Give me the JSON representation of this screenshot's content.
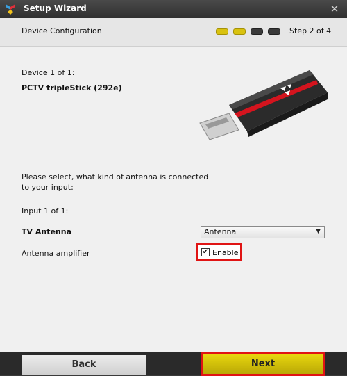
{
  "window": {
    "title": "Setup Wizard",
    "close_glyph": "✕"
  },
  "header": {
    "section": "Device Configuration",
    "step_label": "Step 2 of 4",
    "steps_completed": 2,
    "steps_total": 4
  },
  "device": {
    "counter": "Device 1 of 1:",
    "name": "PCTV tripleStick (292e)",
    "image_icon": "usb-tv-stick-image"
  },
  "antenna": {
    "prompt_line1": "Please select, what kind of antenna is connected",
    "prompt_line2": "to your input:",
    "input_counter": "Input 1 of 1:",
    "type_label": "TV Antenna",
    "type_value": "Antenna",
    "amplifier_label": "Antenna amplifier",
    "amplifier_option": "Enable",
    "amplifier_checked": true
  },
  "footer": {
    "back_label": "Back",
    "next_label": "Next"
  },
  "colors": {
    "accent_yellow": "#d9c20f",
    "highlight_red": "#e01414",
    "titlebar": "#303030"
  }
}
